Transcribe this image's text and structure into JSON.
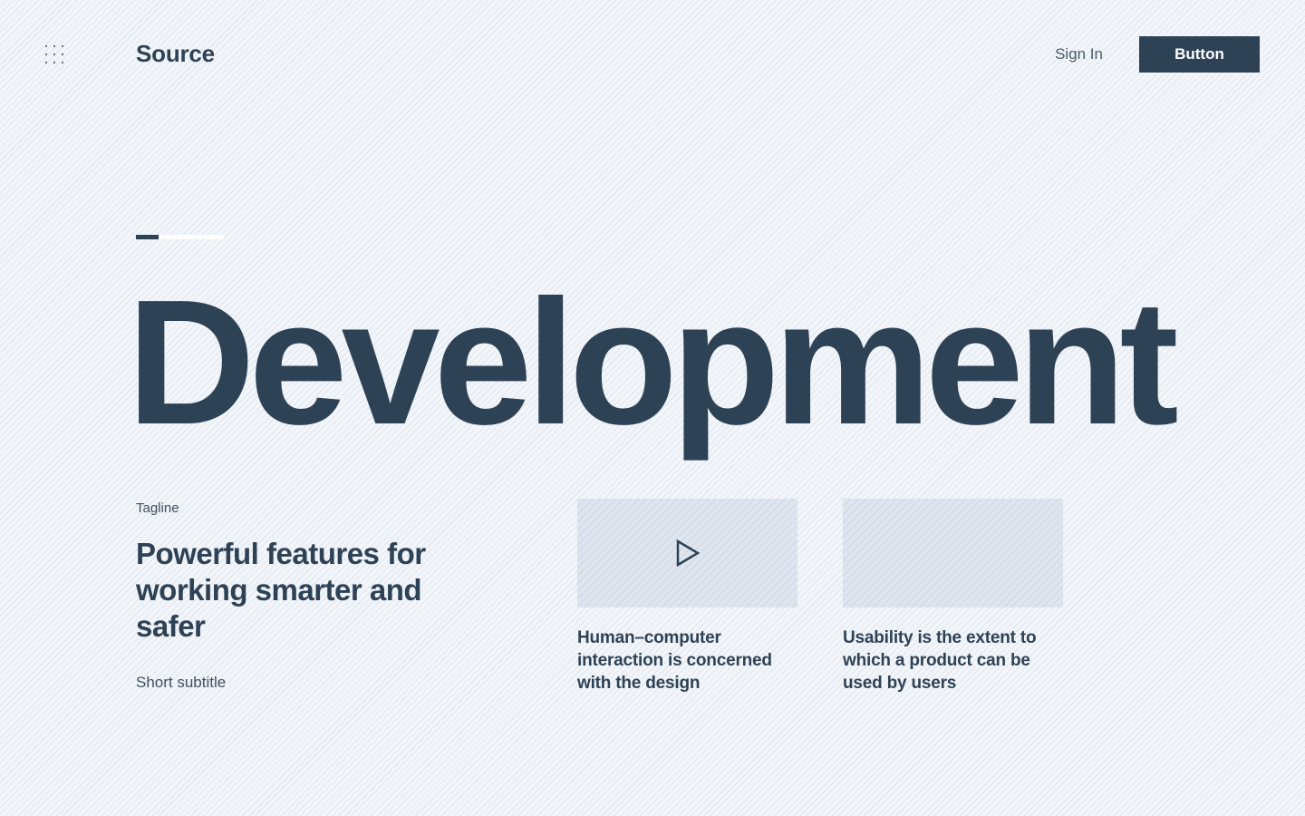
{
  "header": {
    "menu_icon": "grid-dots-icon",
    "brand": "Source",
    "signin_label": "Sign In",
    "cta_label": "Button"
  },
  "progress": {
    "fraction": 0.26
  },
  "hero": {
    "title": "Development"
  },
  "intro": {
    "tagline": "Tagline",
    "headline": "Powerful features for working smarter and safer",
    "subtitle": "Short subtitle"
  },
  "cards": [
    {
      "media_icon": "play-icon",
      "text": "Human–computer interaction is concerned with the design"
    },
    {
      "text": "Usability is the extent to which a product can be used by users"
    }
  ],
  "colors": {
    "primary": "#2e4256",
    "background": "#f2f5f9",
    "card_media": "#dfe5ee"
  }
}
